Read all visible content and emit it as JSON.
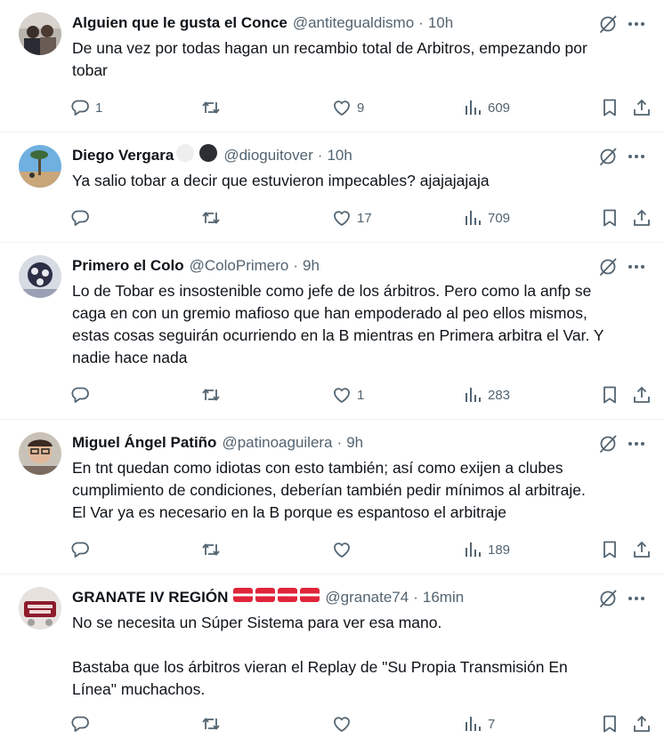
{
  "tweets": [
    {
      "name": "Alguien que le gusta el Conce",
      "handle": "@antitegualdismo",
      "time": "10h",
      "text": [
        "De una vez por todas hagan un recambio total de Arbitros, empezando por",
        "tobar"
      ],
      "replies": "1",
      "retweets": "",
      "likes": "9",
      "views": "609"
    },
    {
      "name": "Diego Vergara",
      "badges": [
        "white-circle",
        "black-circle"
      ],
      "handle": "@dioguitover",
      "time": "10h",
      "text": [
        "Ya salio tobar a decir que estuvieron impecables? ajajajajaja"
      ],
      "replies": "",
      "retweets": "",
      "likes": "17",
      "views": "709"
    },
    {
      "name": "Primero el Colo",
      "handle": "@ColoPrimero",
      "time": "9h",
      "text": [
        "Lo de Tobar es insostenible como jefe de los árbitros. Pero como la anfp se",
        "caga en con un gremio mafioso que han empoderado al peo ellos mismos,",
        "estas cosas seguirán ocurriendo en la B mientras en Primera arbitra el Var. Y",
        "nadie hace nada"
      ],
      "replies": "",
      "retweets": "",
      "likes": "1",
      "views": "283"
    },
    {
      "name": "Miguel Ángel Patiño",
      "handle": "@patinoaguilera",
      "time": "9h",
      "text": [
        "En tnt quedan como idiotas con esto también; así como exijen a clubes",
        "cumplimiento de condiciones, deberían también pedir mínimos al arbitraje.",
        "El Var ya es necesario en la B porque es espantoso el arbitraje"
      ],
      "replies": "",
      "retweets": "",
      "likes": "",
      "views": "189"
    },
    {
      "name": "GRANATE IV REGIÓN",
      "badges": [
        "flag-stripe",
        "flag-stripe",
        "flag-stripe",
        "flag-stripe"
      ],
      "handle": "@granate74",
      "time": "16min",
      "text": [
        "No se necesita un Súper Sistema para ver esa mano.",
        "",
        "Bastaba que los árbitros vieran el Replay de \"Su Propia Transmisión En",
        "Línea\" muchachos."
      ],
      "replies": "",
      "retweets": "",
      "likes": "",
      "views": "7"
    }
  ],
  "colors": {
    "text": "#0f1419",
    "secondary": "#536471",
    "divider": "#eff3f4",
    "flag_red": "#e0243a"
  },
  "icons": [
    "reply-icon",
    "retweet-icon",
    "like-icon",
    "views-icon",
    "bookmark-icon",
    "share-icon",
    "grok-icon",
    "more-icon"
  ]
}
